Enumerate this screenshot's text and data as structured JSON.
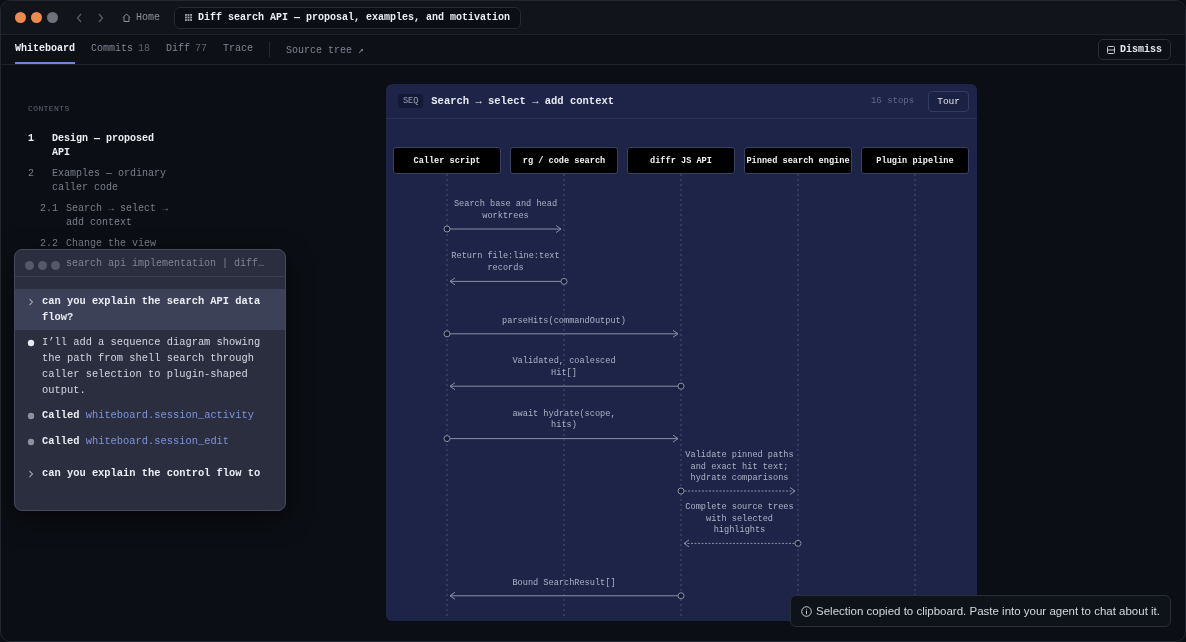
{
  "nav": {
    "home": "Home",
    "document_tab": "Diff search API — proposal, examples, and motivation"
  },
  "tabs": [
    {
      "label": "Whiteboard",
      "selected": true
    },
    {
      "label": "Commits",
      "count": "18",
      "selected": false
    },
    {
      "label": "Diff",
      "count": "77",
      "selected": false
    },
    {
      "label": "Trace",
      "selected": false
    }
  ],
  "source_tree_link": "Source tree ↗",
  "dismiss_button": "Dismiss",
  "contents": {
    "heading": "CONTENTS",
    "items": [
      {
        "number": "1",
        "title": "Design — proposed API",
        "selected": true
      },
      {
        "number": "2",
        "title": "Examples — ordinary caller code",
        "selected": false,
        "children": [
          {
            "number": "2.1",
            "title": "Search → select → add context",
            "selected": false
          },
          {
            "number": "2.2",
            "title": "Change the view",
            "selected": false
          }
        ]
      }
    ]
  },
  "diagram": {
    "badge": "SEQ",
    "title": "Search → select → add context",
    "stops": "16 stops",
    "tour_button": "Tour",
    "participants": [
      "Caller script",
      "rg / code search",
      "diffr JS API",
      "Pinned search engine",
      "Plugin pipeline"
    ],
    "messages": [
      {
        "label": "Search base and head worktrees"
      },
      {
        "label": "Return file:line:text records"
      },
      {
        "label": "parseHits(commandOutput)"
      },
      {
        "label": "Validated, coalesced Hit[]"
      },
      {
        "label": "await hydrate(scope, hits)"
      },
      {
        "label": "Validate pinned paths and exact hit text; hydrate comparisons"
      },
      {
        "label": "Complete source trees with selected highlights"
      },
      {
        "label": "Bound SearchResult[]"
      }
    ]
  },
  "chat": {
    "title": "search api implementation | diff…",
    "messages": [
      {
        "kind": "user",
        "text": "can you explain the search API data flow?",
        "selected": true
      },
      {
        "kind": "assistant",
        "text": "I’ll add a sequence diagram showing the path from shell search through caller selection to plugin-shaped output."
      },
      {
        "kind": "tool",
        "verb": "Called",
        "tool": "whiteboard.session_activity"
      },
      {
        "kind": "tool",
        "verb": "Called",
        "tool": "whiteboard.session_edit"
      },
      {
        "kind": "user",
        "text": "can you explain the control flow to",
        "selected": false
      }
    ]
  },
  "toast": {
    "text": "Selection copied to clipboard. Paste into your agent to chat about it."
  }
}
